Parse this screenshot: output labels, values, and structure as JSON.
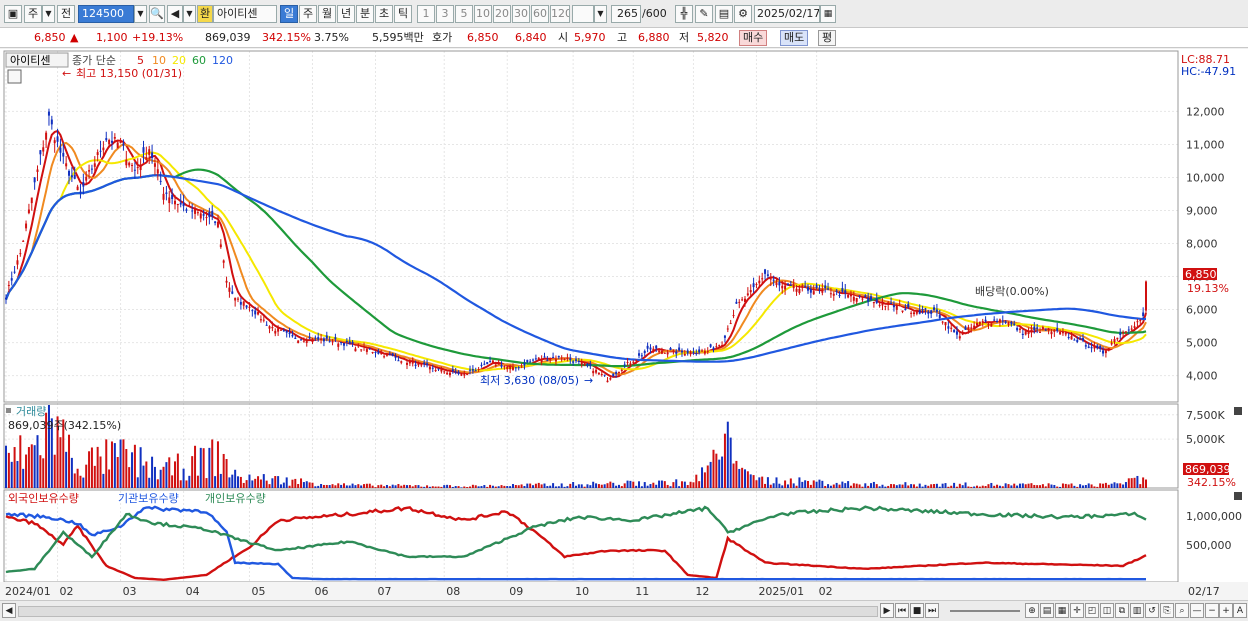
{
  "toolbar": {
    "period_label": "주",
    "prev_label": "전",
    "code": "124500",
    "exchange_badge": "환",
    "stock_name": "아이티센",
    "periods": [
      "일",
      "주",
      "월",
      "년",
      "분",
      "초",
      "틱"
    ],
    "active_period": "일",
    "intervals": [
      "1",
      "3",
      "5",
      "10",
      "20",
      "30",
      "60",
      "120"
    ],
    "count": "265",
    "count_max": "/600",
    "date": "2025/02/17"
  },
  "info": {
    "price": "6,850",
    "change": "1,100",
    "change_pct": "+19.13%",
    "volume": "869,039",
    "volume_ratio": "342.15%",
    "turnover_rate": "3.75%",
    "amount": "5,595백만",
    "quote_label": "호가",
    "ask": "6,850",
    "bid": "6,840",
    "open_label": "시",
    "open": "5,970",
    "high_label": "고",
    "high": "6,880",
    "low_label": "저",
    "low": "5,820",
    "buy_label": "매수",
    "sell_label": "매도",
    "eval_label": "평"
  },
  "price_panel": {
    "name_tag": "아이티센",
    "ma_label": "종가 단순",
    "ma_periods": [
      "5",
      "10",
      "20",
      "60",
      "120"
    ],
    "ma_colors": [
      "#d01010",
      "#f08a20",
      "#f5e800",
      "#1e9a3a",
      "#2058e0"
    ],
    "max_annotation": "최고 13,150 (01/31)",
    "min_annotation": "최저 3,630 (08/05)",
    "dividend_annotation": "배당락(0.00%)",
    "lc": "LC:88.71",
    "hc": "HC:-47.91",
    "current_price_tag": "6,850",
    "current_pct_tag": "19.13%"
  },
  "volume_panel": {
    "title": "거래량",
    "value_text": "869,039주(342.15%)",
    "tag_value": "869,039",
    "tag_pct": "342.15%"
  },
  "holdings_panel": {
    "labels": [
      "외국인보유수량",
      "기관보유수량",
      "개인보유수량"
    ],
    "colors": [
      "#d01010",
      "#2058e0",
      "#2e8b57"
    ],
    "ticks": [
      "1,000,000",
      "500,000"
    ]
  },
  "time_axis": [
    "2024/01",
    "02",
    "03",
    "04",
    "05",
    "06",
    "07",
    "08",
    "09",
    "10",
    "11",
    "12",
    "2025/01",
    "02",
    "02/17"
  ],
  "chart_data": {
    "type": "line",
    "title": "",
    "ylabel": "",
    "xlabel": "",
    "ylim": [
      3200,
      13800
    ],
    "yticks": [
      4000,
      5000,
      6000,
      7000,
      8000,
      9000,
      10000,
      11000,
      12000
    ],
    "close_keypoints": [
      {
        "x": 0,
        "y": 6400
      },
      {
        "x": 5,
        "y": 7700
      },
      {
        "x": 10,
        "y": 9800
      },
      {
        "x": 15,
        "y": 11800
      },
      {
        "x": 20,
        "y": 10500
      },
      {
        "x": 26,
        "y": 9500
      },
      {
        "x": 30,
        "y": 10300
      },
      {
        "x": 35,
        "y": 11200
      },
      {
        "x": 40,
        "y": 11000
      },
      {
        "x": 45,
        "y": 10200
      },
      {
        "x": 50,
        "y": 10900
      },
      {
        "x": 55,
        "y": 9600
      },
      {
        "x": 62,
        "y": 9100
      },
      {
        "x": 70,
        "y": 8800
      },
      {
        "x": 74,
        "y": 8600
      },
      {
        "x": 77,
        "y": 6900
      },
      {
        "x": 80,
        "y": 6300
      },
      {
        "x": 85,
        "y": 6100
      },
      {
        "x": 92,
        "y": 5500
      },
      {
        "x": 100,
        "y": 5150
      },
      {
        "x": 115,
        "y": 5050
      },
      {
        "x": 130,
        "y": 4700
      },
      {
        "x": 145,
        "y": 4300
      },
      {
        "x": 155,
        "y": 4100
      },
      {
        "x": 160,
        "y": 4050
      },
      {
        "x": 170,
        "y": 4400
      },
      {
        "x": 177,
        "y": 4200
      },
      {
        "x": 185,
        "y": 4500
      },
      {
        "x": 195,
        "y": 4550
      },
      {
        "x": 205,
        "y": 4200
      },
      {
        "x": 210,
        "y": 3900
      },
      {
        "x": 216,
        "y": 4300
      },
      {
        "x": 225,
        "y": 4800
      },
      {
        "x": 235,
        "y": 4700
      },
      {
        "x": 245,
        "y": 4750
      },
      {
        "x": 250,
        "y": 5000
      },
      {
        "x": 255,
        "y": 6100
      },
      {
        "x": 260,
        "y": 6500
      },
      {
        "x": 265,
        "y": 7100
      },
      {
        "x": 270,
        "y": 6700
      },
      {
        "x": 280,
        "y": 6600
      },
      {
        "x": 288,
        "y": 6550
      },
      {
        "x": 295,
        "y": 6400
      },
      {
        "x": 305,
        "y": 6200
      },
      {
        "x": 315,
        "y": 6000
      },
      {
        "x": 325,
        "y": 5900
      },
      {
        "x": 332,
        "y": 5200
      },
      {
        "x": 340,
        "y": 5600
      },
      {
        "x": 348,
        "y": 5700
      },
      {
        "x": 355,
        "y": 5300
      },
      {
        "x": 362,
        "y": 5400
      },
      {
        "x": 370,
        "y": 5250
      },
      {
        "x": 378,
        "y": 4900
      },
      {
        "x": 383,
        "y": 4700
      },
      {
        "x": 388,
        "y": 5200
      },
      {
        "x": 393,
        "y": 5500
      },
      {
        "x": 397,
        "y": 5750
      },
      {
        "x": 398,
        "y": 6850
      }
    ],
    "volume_ylim": [
      0,
      8500000
    ],
    "volume_yticks": [
      5000000,
      7500000
    ],
    "volume_keypoints": [
      {
        "x": 0,
        "y": 3200000
      },
      {
        "x": 10,
        "y": 4000000
      },
      {
        "x": 15,
        "y": 7500000
      },
      {
        "x": 25,
        "y": 2500000
      },
      {
        "x": 40,
        "y": 3500000
      },
      {
        "x": 55,
        "y": 1800000
      },
      {
        "x": 75,
        "y": 3500000
      },
      {
        "x": 80,
        "y": 1200000
      },
      {
        "x": 120,
        "y": 300000
      },
      {
        "x": 160,
        "y": 200000
      },
      {
        "x": 240,
        "y": 600000
      },
      {
        "x": 255,
        "y": 5400000
      },
      {
        "x": 260,
        "y": 900000
      },
      {
        "x": 300,
        "y": 400000
      },
      {
        "x": 380,
        "y": 300000
      },
      {
        "x": 398,
        "y": 869039
      }
    ],
    "holdings_ylim": [
      0,
      1250000
    ],
    "holdings_series": [
      {
        "name": "외국인보유수량",
        "color": "#d01010",
        "points": [
          [
            0,
            1050000
          ],
          [
            10,
            950000
          ],
          [
            20,
            600000
          ],
          [
            25,
            900000
          ],
          [
            35,
            250000
          ],
          [
            45,
            50000
          ],
          [
            55,
            20000
          ],
          [
            70,
            100000
          ],
          [
            78,
            350000
          ],
          [
            85,
            550000
          ],
          [
            95,
            1000000
          ],
          [
            120,
            1100000
          ],
          [
            140,
            1200000
          ],
          [
            160,
            1000000
          ],
          [
            175,
            1150000
          ],
          [
            185,
            800000
          ],
          [
            195,
            400000
          ],
          [
            210,
            500000
          ],
          [
            230,
            500000
          ],
          [
            238,
            100000
          ],
          [
            248,
            50000
          ],
          [
            252,
            700000
          ],
          [
            265,
            300000
          ],
          [
            300,
            200000
          ],
          [
            340,
            300000
          ],
          [
            390,
            250000
          ],
          [
            398,
            420000
          ]
        ]
      },
      {
        "name": "기관보유수량",
        "color": "#2058e0",
        "points": [
          [
            0,
            1100000
          ],
          [
            15,
            1050000
          ],
          [
            25,
            950000
          ],
          [
            30,
            750000
          ],
          [
            40,
            900000
          ],
          [
            48,
            1200000
          ],
          [
            70,
            1150000
          ],
          [
            77,
            800000
          ],
          [
            80,
            300000
          ],
          [
            95,
            280000
          ],
          [
            100,
            50000
          ],
          [
            110,
            30000
          ],
          [
            398,
            30000
          ]
        ]
      },
      {
        "name": "개인보유수량",
        "color": "#2e8b57",
        "points": [
          [
            0,
            150000
          ],
          [
            10,
            200000
          ],
          [
            20,
            800000
          ],
          [
            30,
            400000
          ],
          [
            42,
            1100000
          ],
          [
            52,
            950000
          ],
          [
            70,
            850000
          ],
          [
            80,
            700000
          ],
          [
            95,
            500000
          ],
          [
            120,
            650000
          ],
          [
            140,
            400000
          ],
          [
            160,
            400000
          ],
          [
            170,
            600000
          ],
          [
            185,
            900000
          ],
          [
            200,
            1050000
          ],
          [
            220,
            1000000
          ],
          [
            245,
            1200000
          ],
          [
            252,
            800000
          ],
          [
            270,
            1100000
          ],
          [
            300,
            1200000
          ],
          [
            340,
            1100000
          ],
          [
            370,
            1050000
          ],
          [
            395,
            1100000
          ],
          [
            398,
            1000000
          ]
        ]
      }
    ]
  }
}
